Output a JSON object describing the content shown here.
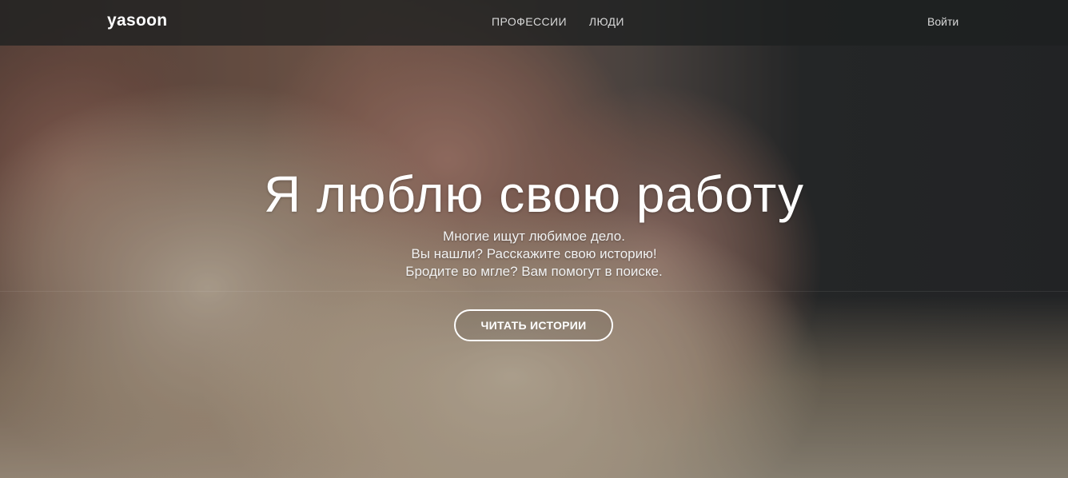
{
  "navbar": {
    "logo": "yasoon",
    "links": [
      {
        "label": "ПРОФЕССИИ"
      },
      {
        "label": "ЛЮДИ"
      }
    ],
    "login_label": "Войти"
  },
  "hero": {
    "headline": "Я люблю свою работу",
    "subtitle_lines": [
      "Многие ищут любимое дело.",
      "Вы нашли? Расскажите свою историю!",
      "Бродите во мгле? Вам помогут в поиске."
    ],
    "cta_label": "ЧИТАТЬ ИСТОРИИ"
  }
}
